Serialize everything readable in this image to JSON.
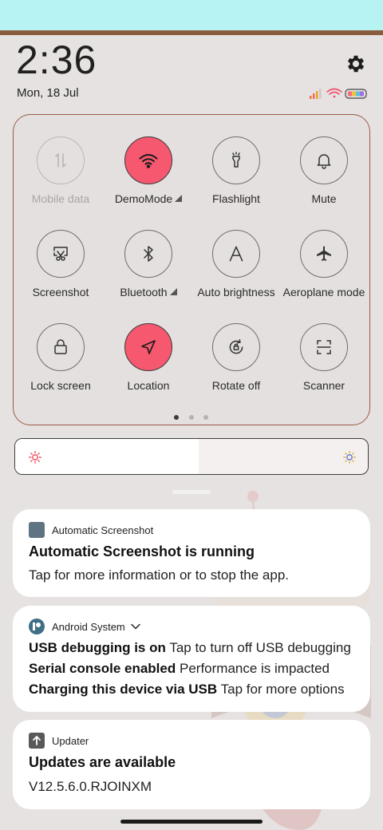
{
  "status": {
    "time": "2:36",
    "date": "Mon, 18 Jul"
  },
  "quick_settings": {
    "tiles": [
      {
        "label": "Mobile data",
        "icon": "mobile-data-icon",
        "state": "disabled"
      },
      {
        "label": "DemoMode",
        "icon": "wifi-icon",
        "state": "active",
        "expand": true
      },
      {
        "label": "Flashlight",
        "icon": "flashlight-icon",
        "state": "off"
      },
      {
        "label": "Mute",
        "icon": "bell-icon",
        "state": "off"
      },
      {
        "label": "Screenshot",
        "icon": "screenshot-icon",
        "state": "off"
      },
      {
        "label": "Bluetooth",
        "icon": "bluetooth-icon",
        "state": "off",
        "expand": true
      },
      {
        "label": "Auto brightness",
        "icon": "auto-brightness-icon",
        "state": "off"
      },
      {
        "label": "Aeroplane mode",
        "icon": "aeroplane-icon",
        "state": "off"
      },
      {
        "label": "Lock screen",
        "icon": "lock-icon",
        "state": "off"
      },
      {
        "label": "Location",
        "icon": "location-icon",
        "state": "active"
      },
      {
        "label": "Rotate off",
        "icon": "rotate-lock-icon",
        "state": "off"
      },
      {
        "label": "Scanner",
        "icon": "scanner-icon",
        "state": "off"
      }
    ],
    "page_indicator": {
      "pages": 3,
      "current": 1
    }
  },
  "brightness": {
    "level_fraction": 0.52
  },
  "notifications": [
    {
      "app": "Automatic Screenshot",
      "title": "Automatic Screenshot is running",
      "text": "Tap for more information or to stop the app."
    },
    {
      "app": "Android System",
      "lines": [
        {
          "title": "USB debugging is on",
          "text": "Tap to turn off USB debugging"
        },
        {
          "title": "Serial console enabled",
          "text": "Performance is impacted"
        },
        {
          "title": "Charging this device via USB",
          "text": "Tap for more options"
        }
      ]
    },
    {
      "app": "Updater",
      "title": "Updates are available",
      "text": "V12.5.6.0.RJOINXM"
    }
  ],
  "colors": {
    "accent_active": "#f5586f",
    "panel_border": "#9b5a48"
  }
}
